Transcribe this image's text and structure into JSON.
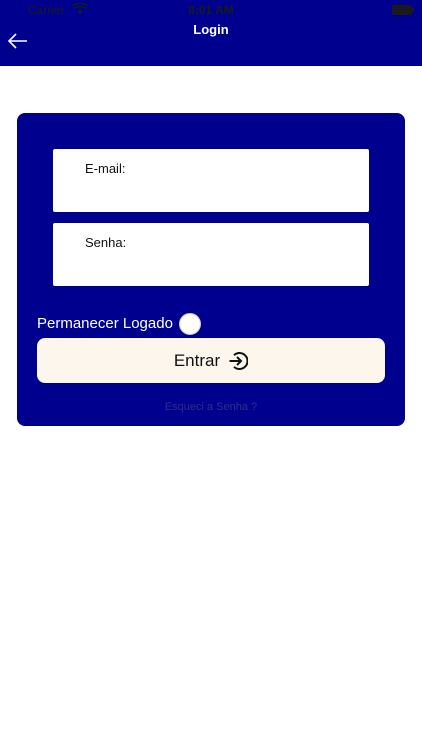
{
  "status_bar": {
    "carrier": "Carrier",
    "time": "8:01 AM"
  },
  "header": {
    "title": "Login",
    "background": "#00008f"
  },
  "form": {
    "email_label": "E-mail:",
    "email_value": "",
    "senha_label": "Senha:",
    "senha_value": "",
    "remember_label": "Permanecer Logado",
    "remember_checked": false,
    "enter_label": "Entrar",
    "forgot_label": "Esqueci a Senha ?"
  },
  "colors": {
    "primary": "#00008f",
    "button_bg": "#fcf6ec"
  },
  "icons": {
    "back": "arrow-left-icon",
    "enter": "login-arrow-circle-icon",
    "wifi": "wifi-icon",
    "battery": "battery-icon"
  }
}
